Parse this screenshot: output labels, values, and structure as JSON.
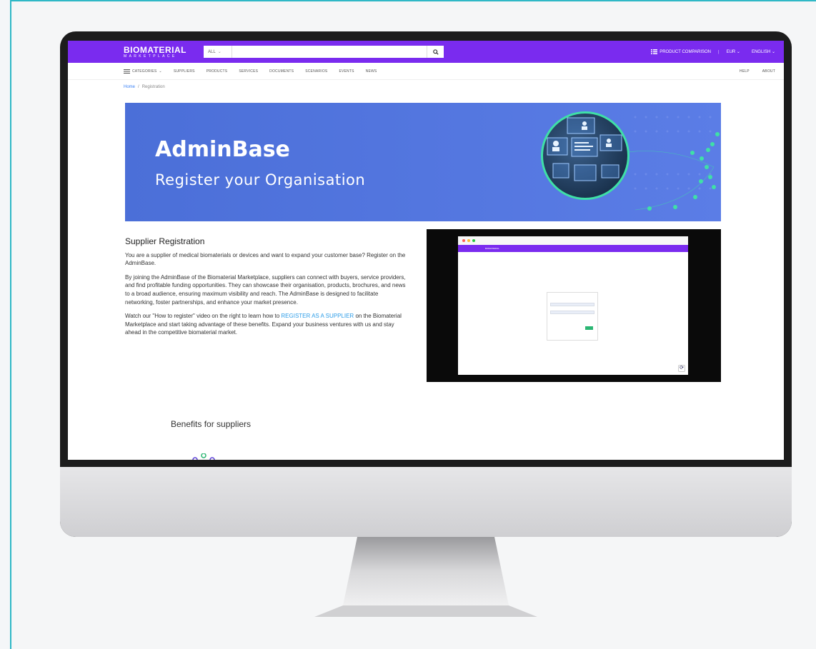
{
  "header": {
    "logo_main": "BIOMATERIAL",
    "logo_sub": "MARKETPLACE",
    "search_category": "ALL",
    "search_placeholder": "",
    "product_comparison": "PRODUCT COMPARISON",
    "currency": "EUR",
    "language": "ENGLISH"
  },
  "nav": {
    "items": [
      "CATEGORIES",
      "SUPPLIERS",
      "PRODUCTS",
      "SERVICES",
      "DOCUMENTS",
      "SCENARIOS",
      "EVENTS",
      "NEWS"
    ],
    "right": [
      "HELP",
      "ABOUT"
    ]
  },
  "breadcrumb": {
    "home": "Home",
    "separator": "/",
    "current": "Registration"
  },
  "banner": {
    "title": "AdminBase",
    "subtitle": "Register your Organisation"
  },
  "content": {
    "heading": "Supplier Registration",
    "p1": "You are a supplier of medical biomaterials or devices and want to expand your customer base? Register on the AdminBase.",
    "p2": "By joining the AdminBase of the Biomaterial Marketplace, suppliers can connect with buyers, service providers, and find profitable funding opportunities. They can showcase their organisation, products, brochures, and news to a broad audience, ensuring maximum visibility and reach. The AdminBase is designed to facilitate networking, foster partnerships, and enhance your market presence.",
    "p3_before": "Watch our \"How to register\" video on the right to learn how to ",
    "p3_link": "REGISTER AS A SUPPLIER",
    "p3_after": " on the Biomaterial Marketplace and start taking advantage of these benefits. Expand your business ventures with us and stay ahead in the competitive biomaterial market."
  },
  "benefits": {
    "heading": "Benefits for suppliers"
  },
  "colors": {
    "brand": "#7a2bef",
    "banner": "#5472de",
    "link": "#2f9ee8",
    "accent": "#3fe0a7",
    "frame": "#2fb8c6"
  }
}
